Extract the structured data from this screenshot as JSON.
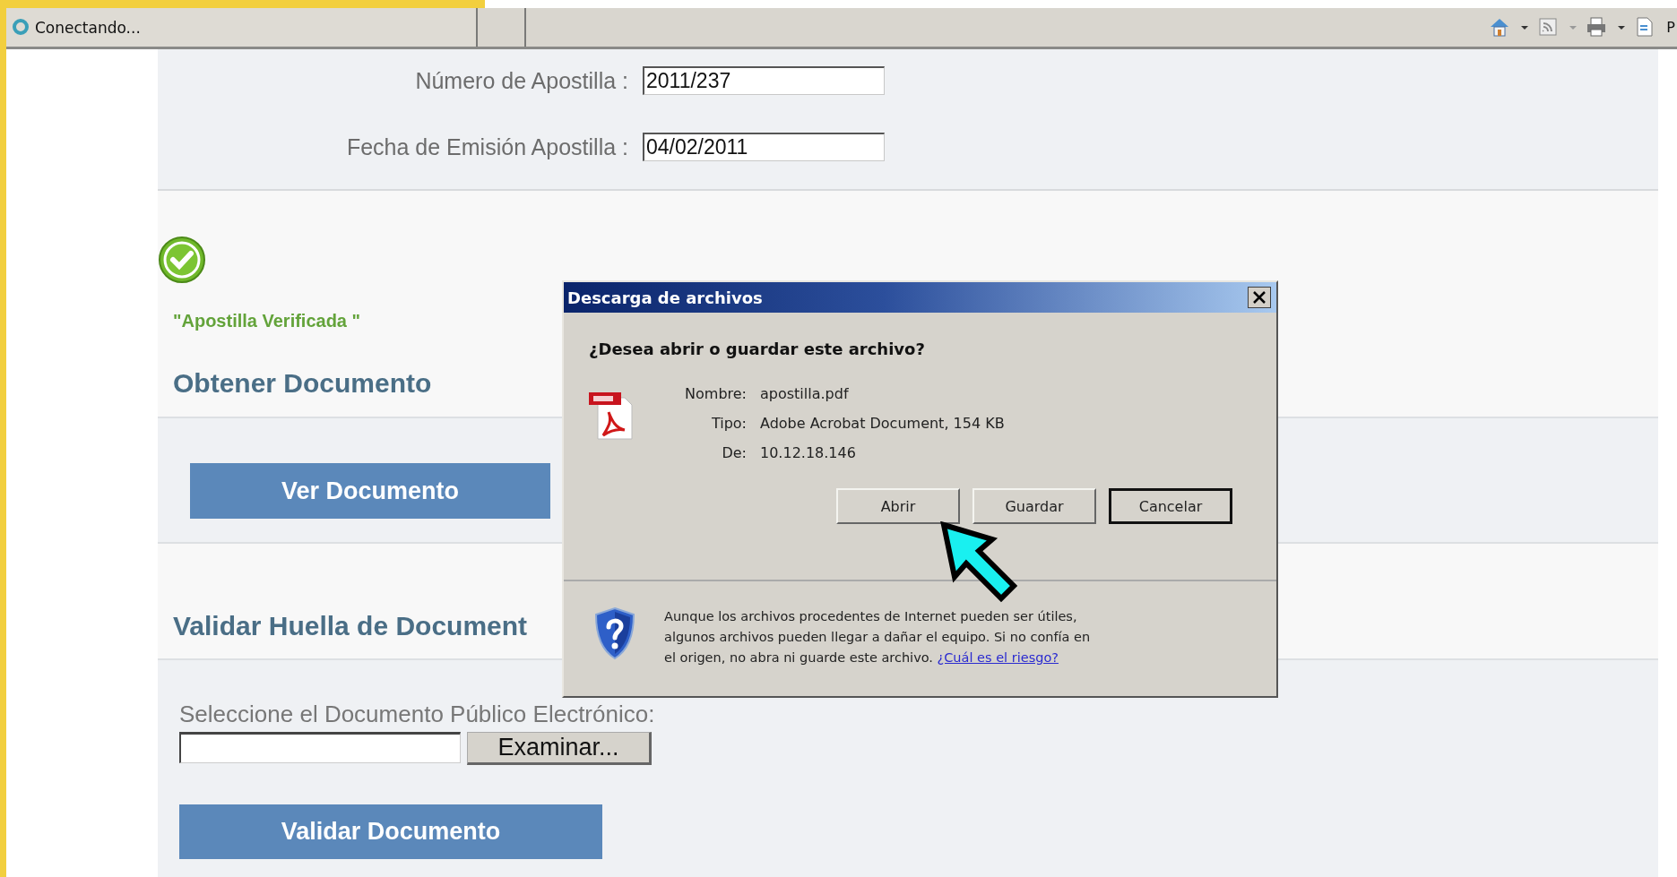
{
  "browser": {
    "status": "Conectando...",
    "toolbar_label": "P"
  },
  "form": {
    "fields": [
      {
        "label": "Número de Apostilla :",
        "value": "2011/237"
      },
      {
        "label": "Fecha de Emisión Apostilla :",
        "value": "04/02/2011"
      }
    ]
  },
  "verification": {
    "verified": true,
    "message": "\"Apostilla Verificada \""
  },
  "sections": [
    {
      "kind": "button",
      "heading": "Obtener Documento",
      "button": "Ver Documento"
    },
    {
      "kind": "upload",
      "heading": "Validar Huella de Document",
      "file_label": "Seleccione el Documento Público Electrónico:",
      "browse_button": "Examinar...",
      "button": "Validar Documento"
    }
  ],
  "dialog": {
    "title": "Descarga de archivos",
    "question": "¿Desea abrir o guardar este archivo?",
    "details": [
      {
        "label": "Nombre:",
        "value": "apostilla.pdf"
      },
      {
        "label": "Tipo:",
        "value": "Adobe Acrobat Document, 154 KB"
      },
      {
        "label": "De:",
        "value": "10.12.18.146"
      }
    ],
    "buttons": [
      {
        "label": "Abrir",
        "focused": false
      },
      {
        "label": "Guardar",
        "focused": false
      },
      {
        "label": "Cancelar",
        "focused": true
      }
    ],
    "warning_lines": [
      "Aunque los archivos procedentes de Internet pueden ser útiles,",
      "algunos archivos pueden llegar a dañar el equipo. Si no confía en",
      "el origen, no abra ni guarde este archivo."
    ],
    "link": "¿Cuál es el riesgo?"
  }
}
